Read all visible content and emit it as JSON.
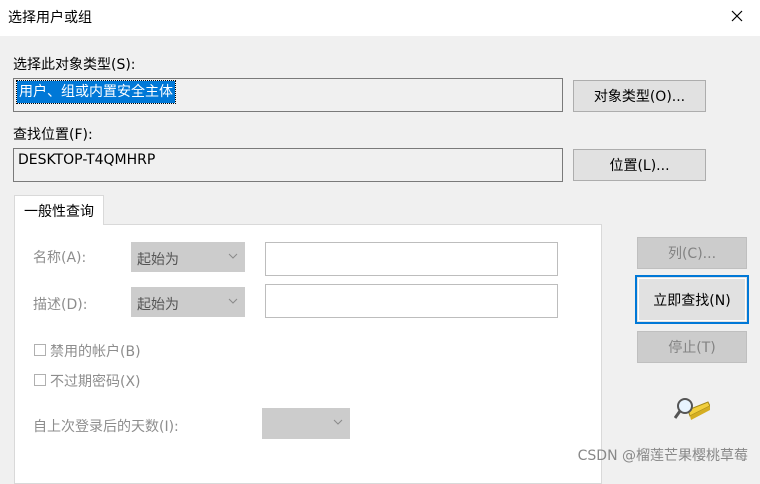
{
  "window": {
    "title": "选择用户或组"
  },
  "object_type": {
    "label": "选择此对象类型(S):",
    "value": "用户、组或内置安全主体",
    "button": "对象类型(O)..."
  },
  "location": {
    "label": "查找位置(F):",
    "value": "DESKTOP-T4QMHRP",
    "button": "位置(L)..."
  },
  "tab": {
    "label": "一般性查询"
  },
  "query": {
    "name_label": "名称(A):",
    "name_mode": "起始为",
    "desc_label": "描述(D):",
    "desc_mode": "起始为",
    "disabled_accounts": "禁用的帐户(B)",
    "non_expiring": "不过期密码(X)",
    "last_login_label": "自上次登录后的天数(I):"
  },
  "buttons": {
    "columns": "列(C)...",
    "find_now": "立即查找(N)",
    "stop": "停止(T)"
  },
  "watermark": "CSDN @榴莲芒果樱桃草莓"
}
